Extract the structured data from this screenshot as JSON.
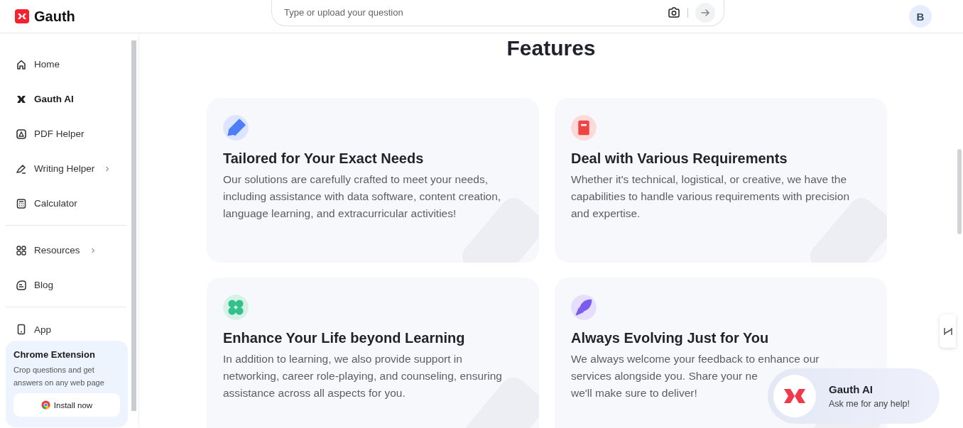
{
  "header": {
    "logo": "Gauth",
    "search": {
      "placeholder": "Type or upload your question"
    },
    "avatar": "B"
  },
  "sidebar": {
    "groups": [
      {
        "items": [
          {
            "label": "Home",
            "kind": "home",
            "selected": false,
            "has_submenu": false
          },
          {
            "label": "Gauth AI",
            "kind": "gauth",
            "selected": true,
            "has_submenu": false
          },
          {
            "label": "PDF Helper",
            "kind": "pdf",
            "selected": false,
            "has_submenu": false
          },
          {
            "label": "Writing Helper",
            "kind": "pen",
            "selected": false,
            "has_submenu": true
          },
          {
            "label": "Calculator",
            "kind": "calculator",
            "selected": false,
            "has_submenu": false
          }
        ]
      },
      {
        "items": [
          {
            "label": "Resources",
            "kind": "grid",
            "selected": false,
            "has_submenu": true
          },
          {
            "label": "Blog",
            "kind": "blog",
            "selected": false,
            "has_submenu": false
          }
        ]
      },
      {
        "items": [
          {
            "label": "App",
            "kind": "phone",
            "selected": false,
            "has_submenu": false
          }
        ]
      }
    ],
    "promo": {
      "title": "Chrome Extension",
      "text": "Crop questions and get answers on any web page",
      "button": "Install now"
    }
  },
  "main": {
    "title": "Features",
    "cards": [
      {
        "kind": "pencil",
        "color": "#4f7cf7",
        "title": "Tailored for Your Exact Needs",
        "description": "Our solutions are carefully crafted to meet your needs, including assistance with data software, content creation, language learning, and extracurricular activities!"
      },
      {
        "kind": "book",
        "color": "#ef4444",
        "title": "Deal with Various Requirements",
        "description": "Whether it's technical, logistical, or creative, we have the capabilities to handle various requirements with precision and expertise."
      },
      {
        "kind": "clover",
        "color": "#34c08a",
        "title": "Enhance Your Life beyond Learning",
        "description": "In addition to learning, we also provide support in networking, career role-playing, and counseling, ensuring assistance across all aspects for you."
      },
      {
        "kind": "rocket",
        "color": "#7c5cf0",
        "title": "Always Evolving Just for You",
        "description": "We always welcome your feedback to enhance our services alongside you. Share your ne",
        "description_tail": "we'll make sure to deliver!"
      }
    ]
  },
  "assistant": {
    "title": "Gauth AI",
    "subtitle": "Ask me for any help!"
  }
}
